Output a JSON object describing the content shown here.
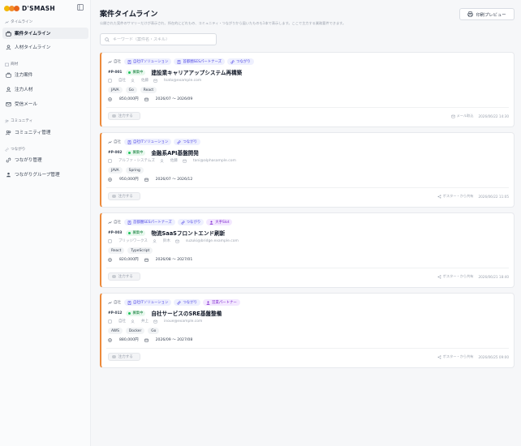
{
  "brand": {
    "name": "D'SMASH",
    "colors": [
      "#f2b705",
      "#f28c28",
      "#e8651b"
    ]
  },
  "sidebar": {
    "sections": [
      {
        "label": "タイムライン",
        "icon": "timeline-icon"
      },
      {
        "label": "商材",
        "icon": "box-icon"
      },
      {
        "label": "コミュニティ",
        "icon": "community-icon"
      },
      {
        "label": "つながり",
        "icon": "link-icon"
      }
    ],
    "items": [
      {
        "label": "案件タイムライン",
        "icon": "briefcase-icon",
        "active": true
      },
      {
        "label": "人材タイムライン",
        "icon": "user-icon"
      },
      {
        "label": "注力案件",
        "icon": "briefcase-icon"
      },
      {
        "label": "注力人材",
        "icon": "user-icon"
      },
      {
        "label": "受信メール",
        "icon": "mail-icon"
      },
      {
        "label": "コミュニティ管理",
        "icon": "users-icon"
      },
      {
        "label": "つながり管理",
        "icon": "link-icon"
      },
      {
        "label": "つながりグループ管理",
        "icon": "group-icon"
      }
    ]
  },
  "header": {
    "title": "案件タイムライン",
    "description": "公開された案件のサマリーだけが表示され、所在的にどれもの、コミュニティ・つながりから届いたものも1本で表示します。ここで主力する業務要件できます。",
    "print_button": "印刷プレビュー",
    "search_placeholder": "キーワード（案件名・スキル）"
  },
  "accent_color": "#ec8a3a",
  "cards": [
    {
      "source": "自社",
      "tags": [
        {
          "label": "自社ITソリューション",
          "kind": "blue",
          "icon": "building-icon"
        },
        {
          "label": "首都圏SESパートナーズ",
          "kind": "blue",
          "icon": "building-icon"
        },
        {
          "label": "つながり",
          "kind": "blue",
          "icon": "link-icon"
        }
      ],
      "code": "#P-001",
      "status": "募集中",
      "title": "建設業キャリアアップシステム再構築",
      "company": "自社",
      "person": "佐藤",
      "email": "tsato@example.com",
      "skills": [
        "JAVA",
        "Go",
        "React"
      ],
      "price": "850,000円",
      "period": "2026/07 〜 2026/09",
      "apply": "注力する",
      "channel": "メール取込",
      "date": "2026/06/22 14:30",
      "channel_icon": "mail-icon"
    },
    {
      "source": "自社",
      "tags": [
        {
          "label": "自社ITソリューション",
          "kind": "blue",
          "icon": "building-icon"
        },
        {
          "label": "つながり",
          "kind": "blue",
          "icon": "link-icon"
        }
      ],
      "code": "#P-002",
      "status": "募集中",
      "title": "金融系API基盤開発",
      "company": "アルファ・システムズ",
      "person": "佐藤",
      "email": "tani@alphasample.com",
      "skills": [
        "JAVA",
        "Spring"
      ],
      "price": "950,000円",
      "period": "2026/07 〜 2026/12",
      "apply": "注力する",
      "channel": "ポスター・から共有",
      "date": "2026/06/22 11:05",
      "channel_icon": "share-icon"
    },
    {
      "source": "自社",
      "tags": [
        {
          "label": "首都圏SESパートナーズ",
          "kind": "blue",
          "icon": "building-icon"
        },
        {
          "label": "つながり",
          "kind": "blue",
          "icon": "link-icon"
        },
        {
          "label": "大手Slot",
          "kind": "purple",
          "icon": "users-icon"
        }
      ],
      "code": "#P-003",
      "status": "募集中",
      "title": "物流SaaSフロントエンド刷新",
      "company": "ブリッジワークス",
      "person": "鈴木",
      "email": "suzuki@bridge.example.com",
      "skills": [
        "React",
        "TypeScript"
      ],
      "price": "820,000円",
      "period": "2026/08 〜 2027/01",
      "apply": "注力する",
      "channel": "ポスター・から共有",
      "date": "2026/06/21 18:40",
      "channel_icon": "share-icon"
    },
    {
      "source": "自社",
      "tags": [
        {
          "label": "自社ITソリューション",
          "kind": "blue",
          "icon": "building-icon"
        },
        {
          "label": "つながり",
          "kind": "blue",
          "icon": "link-icon"
        },
        {
          "label": "営業パートナー",
          "kind": "purple",
          "icon": "users-icon"
        }
      ],
      "code": "#P-012",
      "status": "募集中",
      "title": "自社サービスのSRE基盤整備",
      "company": "自社",
      "person": "井上",
      "email": "inoue@example.com",
      "skills": [
        "AWS",
        "Docker",
        "Go"
      ],
      "price": "880,000円",
      "period": "2026/09 〜 2027/08",
      "apply": "注力する",
      "channel": "ポスター・から共有",
      "date": "2026/06/25 09:00",
      "channel_icon": "share-icon"
    }
  ]
}
